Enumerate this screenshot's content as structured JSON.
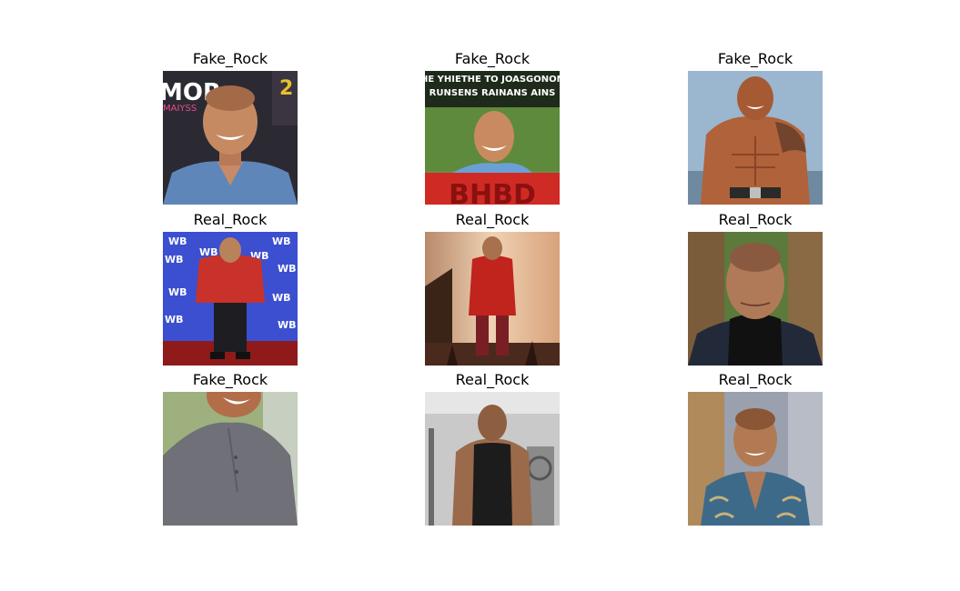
{
  "grid": {
    "items": [
      {
        "label": "Fake_Rock",
        "scene": "event-backdrop"
      },
      {
        "label": "Fake_Rock",
        "scene": "meme-poster",
        "caption_line1": "THE YHIETHE TO JOASGONONE",
        "caption_line2": "RUNSENS RAINANS AINS",
        "bottom_text": "BHBD"
      },
      {
        "label": "Fake_Rock",
        "scene": "tattooed-torso"
      },
      {
        "label": "Real_Rock",
        "scene": "wb-red-carpet"
      },
      {
        "label": "Real_Rock",
        "scene": "stage-red-shirt"
      },
      {
        "label": "Real_Rock",
        "scene": "turtleneck-portrait"
      },
      {
        "label": "Fake_Rock",
        "scene": "grey-henley-smile"
      },
      {
        "label": "Real_Rock",
        "scene": "gym-tank-top"
      },
      {
        "label": "Real_Rock",
        "scene": "paisley-jacket"
      }
    ]
  }
}
